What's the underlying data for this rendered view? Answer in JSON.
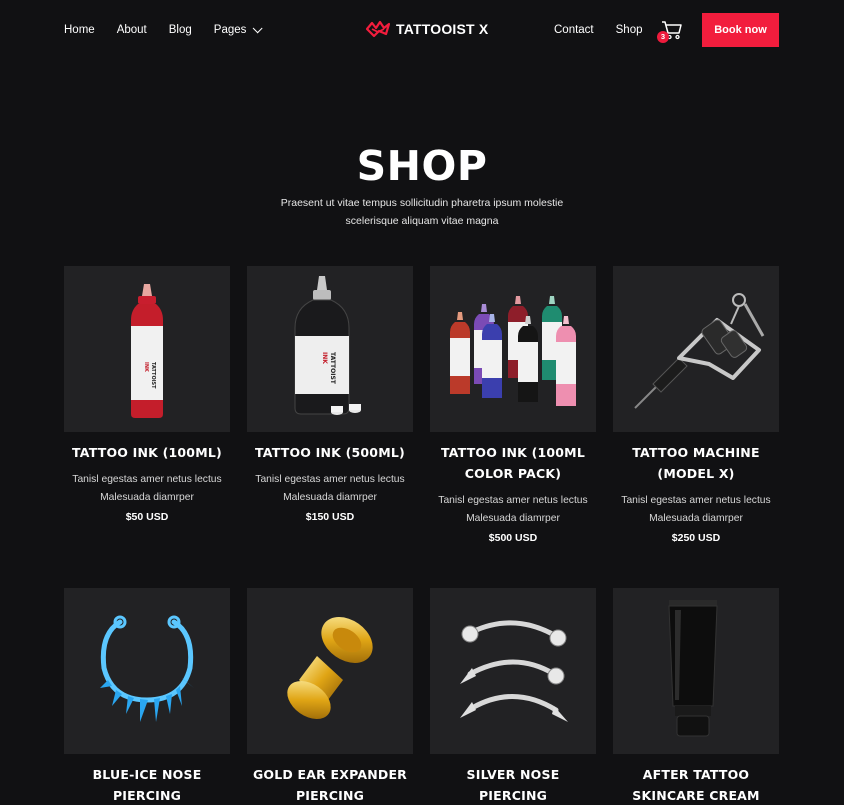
{
  "nav": {
    "left_links": [
      {
        "label": "Home"
      },
      {
        "label": "About"
      },
      {
        "label": "Blog"
      },
      {
        "label": "Pages"
      }
    ],
    "brand": "TATTOOIST X",
    "right_links": [
      {
        "label": "Contact"
      },
      {
        "label": "Shop"
      }
    ],
    "cart_count": "3",
    "book_label": "Book now"
  },
  "hero": {
    "title": "SHOP",
    "subtitle": "Praesent ut vitae tempus sollicitudin pharetra ipsum molestie scelerisque aliquam vitae magna"
  },
  "products": [
    {
      "name": "TATTOO INK (100ML)",
      "desc": "Tanisl egestas amer netus lectus Malesuada diamrper",
      "price": "$50 USD",
      "icon": "red-ink-bottle-icon"
    },
    {
      "name": "TATTOO INK (500ML)",
      "desc": "Tanisl egestas amer netus lectus Malesuada diamrper",
      "price": "$150 USD",
      "icon": "black-ink-bottle-icon"
    },
    {
      "name": "TATTOO INK (100ML COLOR PACK)",
      "desc": "Tanisl egestas amer netus lectus Malesuada diamrper",
      "price": "$500 USD",
      "icon": "ink-color-pack-icon"
    },
    {
      "name": "TATTOO MACHINE (MODEL X)",
      "desc": "Tanisl egestas amer netus lectus Malesuada diamrper",
      "price": "$250 USD",
      "icon": "tattoo-machine-icon"
    },
    {
      "name": "BLUE-ICE NOSE PIERCING",
      "desc": "",
      "price": "",
      "icon": "nose-ring-icon"
    },
    {
      "name": "GOLD EAR EXPANDER PIERCING",
      "desc": "",
      "price": "",
      "icon": "ear-expander-icon"
    },
    {
      "name": "SILVER NOSE PIERCING",
      "desc": "",
      "price": "",
      "icon": "silver-barbells-icon"
    },
    {
      "name": "AFTER TATTOO SKINCARE CREAM",
      "desc": "",
      "price": "",
      "icon": "cream-tube-icon"
    }
  ],
  "bottle_label": "TATTOIST INK",
  "colors": {
    "accent": "#f21d3d",
    "background": "#111113",
    "card": "#222224"
  }
}
